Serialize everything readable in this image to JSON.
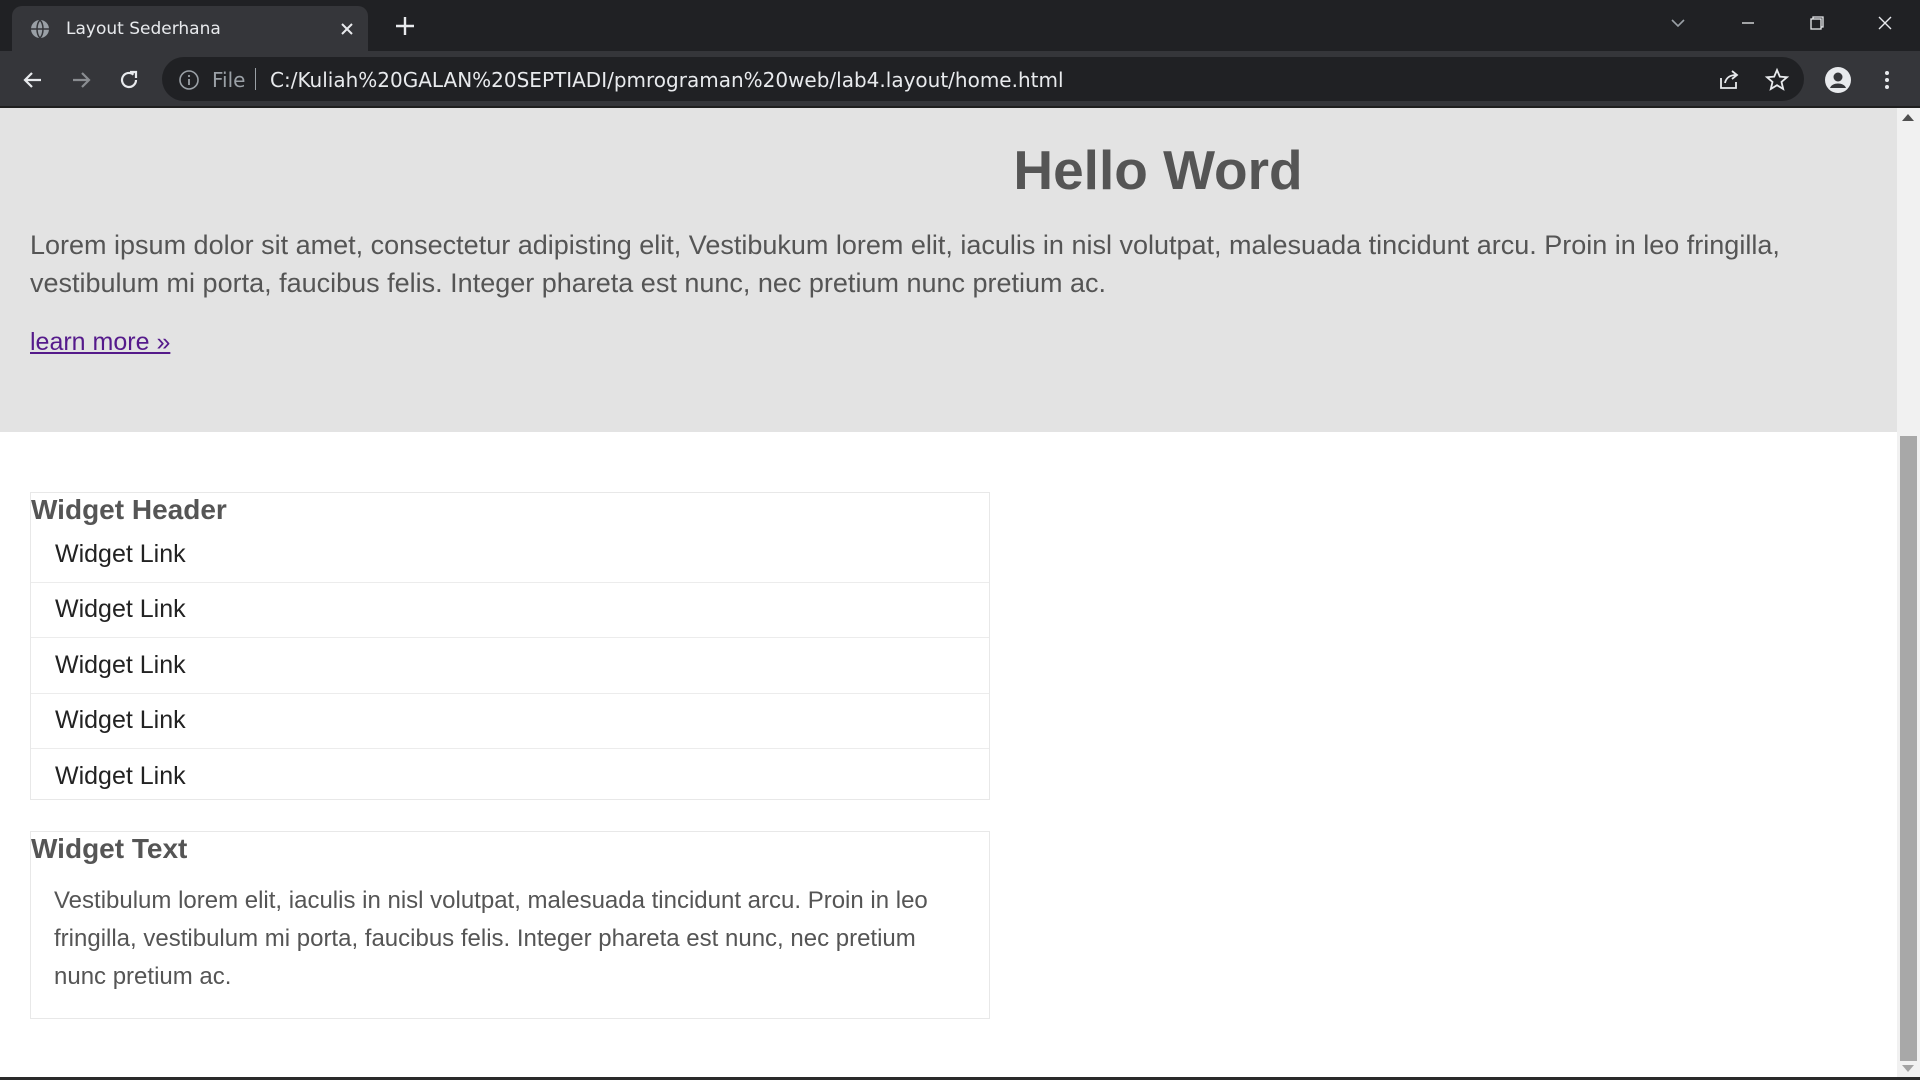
{
  "browser": {
    "tab_title": "Layout Sederhana",
    "scheme_label": "File",
    "url": "C:/Kuliah%20GALAN%20SEPTIADI/pmrograman%20web/lab4.layout/home.html",
    "icons": {
      "favicon": "globe-icon",
      "back": "back-arrow-icon",
      "forward": "forward-arrow-icon",
      "reload": "reload-icon",
      "info": "info-icon",
      "share": "share-icon",
      "bookmark": "star-icon",
      "profile": "profile-icon",
      "menu": "kebab-menu-icon"
    }
  },
  "hero": {
    "title": "Hello Word",
    "text": "Lorem ipsum dolor sit amet, consectetur adipisting elit, Vestibukum lorem elit, iaculis in nisl volutpat, malesuada tincidunt arcu. Proin in leo fringilla, vestibulum mi porta, faucibus felis. Integer phareta est nunc, nec pretium nunc pretium ac.",
    "link": "learn more »"
  },
  "widget_links": {
    "header": "Widget Header",
    "links": [
      "Widget Link",
      "Widget Link",
      "Widget Link",
      "Widget Link",
      "Widget Link"
    ]
  },
  "widget_text": {
    "header": "Widget Text",
    "body": "Vestibulum lorem elit, iaculis in nisl volutpat, malesuada tincidunt arcu. Proin in leo fringilla, vestibulum mi porta, faucibus felis. Integer phareta est nunc, nec pretium nunc pretium ac."
  },
  "colors": {
    "chrome_dark": "#202124",
    "chrome_toolbar": "#35363a",
    "hero_bg": "#e3e3e3",
    "text_gray": "#555555",
    "visited_link": "#551a8b"
  }
}
